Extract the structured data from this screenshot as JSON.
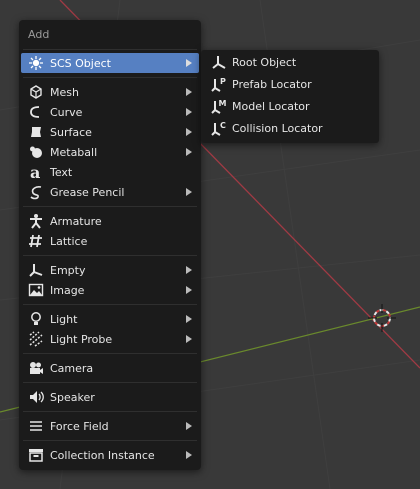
{
  "colors": {
    "viewport_bg": "#393939",
    "grid_line": "#3f3f3f",
    "x_axis": "#a03a44",
    "y_axis": "#6a8a2c",
    "menu_bg": "#1b1b1b",
    "highlight": "#5680c2",
    "text": "#e6e6e6",
    "title_text": "#9a9a9a"
  },
  "menu": {
    "title": "Add",
    "items": [
      {
        "label": "SCS Object",
        "icon": "scs-object-icon",
        "submenu": true,
        "active": true
      },
      {
        "label": "Mesh",
        "icon": "mesh-icon",
        "submenu": true
      },
      {
        "label": "Curve",
        "icon": "curve-icon",
        "submenu": true
      },
      {
        "label": "Surface",
        "icon": "surface-icon",
        "submenu": true
      },
      {
        "label": "Metaball",
        "icon": "metaball-icon",
        "submenu": true
      },
      {
        "label": "Text",
        "icon": "text-icon",
        "submenu": false
      },
      {
        "label": "Grease Pencil",
        "icon": "grease-pencil-icon",
        "submenu": true
      },
      {
        "label": "Armature",
        "icon": "armature-icon",
        "submenu": false
      },
      {
        "label": "Lattice",
        "icon": "lattice-icon",
        "submenu": false
      },
      {
        "label": "Empty",
        "icon": "empty-icon",
        "submenu": true
      },
      {
        "label": "Image",
        "icon": "image-icon",
        "submenu": true
      },
      {
        "label": "Light",
        "icon": "light-icon",
        "submenu": true
      },
      {
        "label": "Light Probe",
        "icon": "light-probe-icon",
        "submenu": true
      },
      {
        "label": "Camera",
        "icon": "camera-icon",
        "submenu": false
      },
      {
        "label": "Speaker",
        "icon": "speaker-icon",
        "submenu": false
      },
      {
        "label": "Force Field",
        "icon": "force-field-icon",
        "submenu": true
      },
      {
        "label": "Collection Instance",
        "icon": "collection-instance-icon",
        "submenu": true
      }
    ]
  },
  "submenu": {
    "items": [
      {
        "label": "Root Object",
        "icon": "root-object-icon"
      },
      {
        "label": "Prefab Locator",
        "icon": "prefab-locator-icon"
      },
      {
        "label": "Model Locator",
        "icon": "model-locator-icon"
      },
      {
        "label": "Collision Locator",
        "icon": "collision-locator-icon"
      }
    ]
  }
}
